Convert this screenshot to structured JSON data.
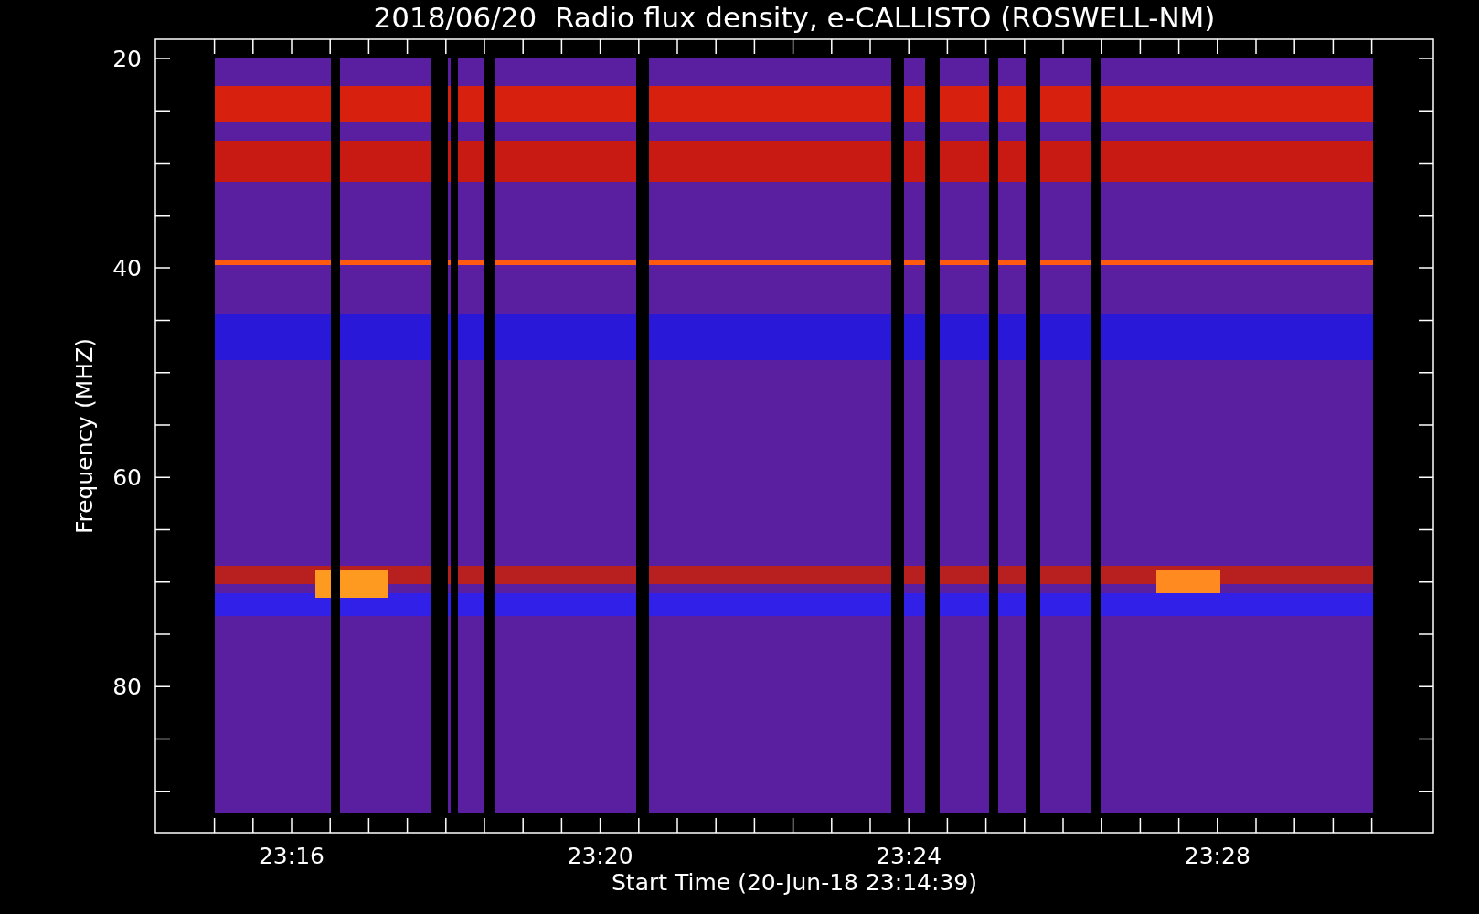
{
  "chart": {
    "title": "2018/06/20  Radio flux density, e-CALLISTO (ROSWELL-NM)",
    "ylabel": "Frequency (MHZ)",
    "xlabel": "Start Time (20-Jun-18 23:14:39)",
    "yticks": [
      "20",
      "40",
      "60",
      "80"
    ],
    "xticks": [
      "23:16",
      "23:20",
      "23:24",
      "23:28"
    ]
  }
}
